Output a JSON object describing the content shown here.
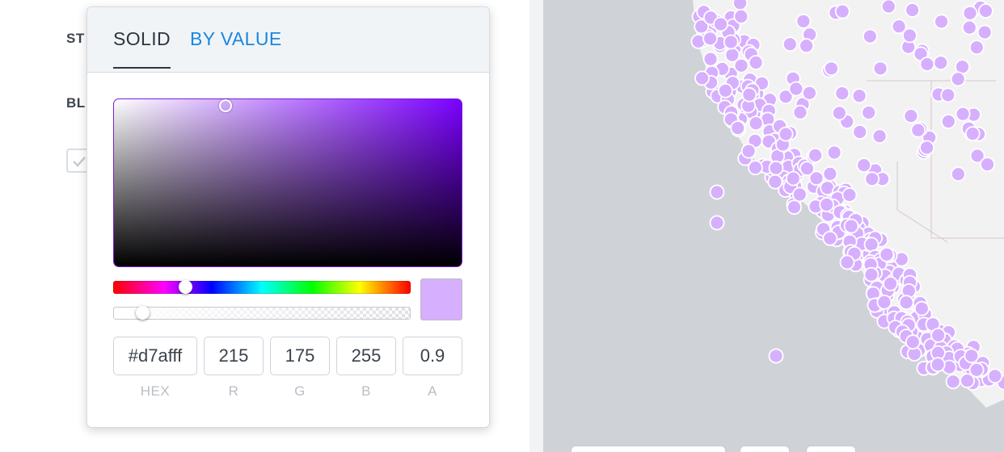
{
  "settings_panel": {
    "label_1": "ST",
    "label_2": "BL",
    "checkbox_checked": true
  },
  "color_picker": {
    "tabs": [
      {
        "label": "SOLID",
        "active": true
      },
      {
        "label": "BY VALUE",
        "active": false
      }
    ],
    "hue_color": "#7b00ff",
    "selected_color": "#d7afff",
    "fields": {
      "hex": {
        "value": "#d7afff",
        "label": "HEX"
      },
      "r": {
        "value": "215",
        "label": "R"
      },
      "g": {
        "value": "175",
        "label": "G"
      },
      "b": {
        "value": "255",
        "label": "B"
      },
      "a": {
        "value": "0.9",
        "label": "A"
      }
    }
  },
  "map": {
    "point_color": "#d7afff",
    "land_color": "#f2f2f2",
    "water_color": "#cfd3d7"
  },
  "colors": {
    "tab_active": "#2d3640",
    "tab_link": "#1a87de"
  }
}
